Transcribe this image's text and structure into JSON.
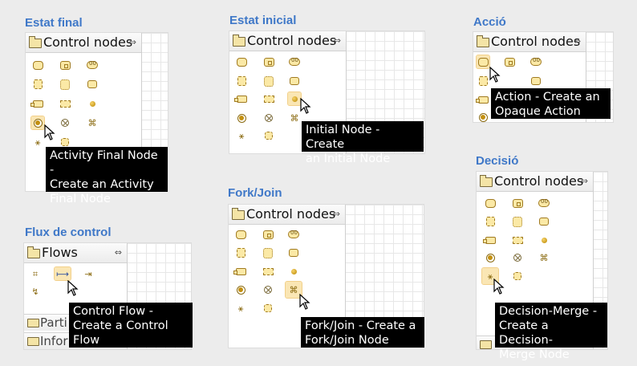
{
  "captions": {
    "final": "Estat final",
    "initial": "Estat inicial",
    "action": "Acció",
    "flow": "Flux de control",
    "forkjoin": "Fork/Join",
    "decision": "Decisió"
  },
  "palette": {
    "control_nodes": "Control nodes",
    "flows": "Flows",
    "partitions": "Parti",
    "information": "Infor"
  },
  "tooltips": {
    "final": "Activity Final Node -\nCreate an Activity\nFinal Node",
    "initial": "Initial Node - Create\nan Initial Node",
    "action": "Action - Create an\nOpaque Action",
    "flow": "Control Flow -\nCreate a Control\nFlow",
    "forkjoin": "Fork/Join - Create a\nFork/Join Node",
    "decision": "Decision-Merge -\nCreate a Decision-\nMerge Node"
  },
  "icons": {
    "collapse": "collapse-icon",
    "folder": "folder-icon",
    "cursor": "mouse-pointer-icon"
  },
  "colors": {
    "caption": "#3f78c8",
    "highlight": "#fae6b4",
    "tooltip_bg": "#000000"
  }
}
